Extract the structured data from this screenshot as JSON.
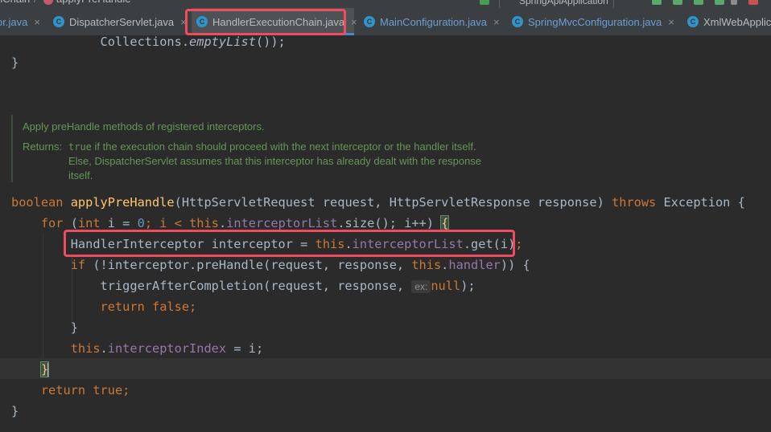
{
  "toolbar": {
    "breadcrumb_prefix": "nChain",
    "breadcrumb_sep": "/",
    "breadcrumb_method": "applyPreHandle",
    "run_config": "SpringApiApplication"
  },
  "tabs": [
    {
      "label": "or.java",
      "close": "×"
    },
    {
      "label": "DispatcherServlet.java",
      "close": "×"
    },
    {
      "label": "HandlerExecutionChain.java",
      "close": "×"
    },
    {
      "label": "MainConfiguration.java",
      "close": "×"
    },
    {
      "label": "SpringMvcConfiguration.java",
      "close": "×"
    },
    {
      "label": "XmlWebApplic",
      "close": ""
    }
  ],
  "icons": {
    "class_file": "C",
    "method_icon": "m"
  },
  "colors": {
    "highlight": "#ef4d5f",
    "accent": "#4a88c7",
    "keyword": "#cc7832",
    "method": "#ffc66d",
    "field": "#9876aa",
    "number": "#6897bb",
    "doc": "#629755"
  },
  "code": {
    "l1_call": "Collections.",
    "l1_method": "emptyList",
    "l1_end": "());",
    "l2": "}",
    "sig_kw": "boolean",
    "sig_name": "applyPreHandle",
    "sig_params": "(HttpServletRequest request, HttpServletResponse response) ",
    "sig_throws": "throws",
    "sig_exc": " Exception {",
    "for_kw": "for",
    "for_open": " (",
    "for_int": "int",
    "for_i": " i = ",
    "for_zero": "0",
    "for_semi1": "; i < ",
    "for_this": "this",
    "for_dot": ".",
    "for_field": "interceptorList",
    "for_size": ".size(); i++) ",
    "for_brace": "{",
    "decl_type": "HandlerInterceptor interceptor = ",
    "decl_this": "this",
    "decl_dot": ".",
    "decl_field": "interceptorList",
    "decl_get": ".get(i)",
    "decl_semi": ";",
    "if_kw": "if",
    "if_cond": " (!interceptor.preHandle(request, response, ",
    "if_this": "this",
    "if_dot": ".",
    "if_field": "handler",
    "if_end": ")) {",
    "trigger_call": "triggerAfterCompletion(request, response, ",
    "trigger_hint": "ex:",
    "trigger_null": "null",
    "trigger_end": ");",
    "ret_kw": "return",
    "ret_false": " false",
    "ret_semi": ";",
    "close_if": "}",
    "assign_this": "this",
    "assign_dot": ".",
    "assign_field": "interceptorIndex",
    "assign_end": " = i;",
    "close_for": "}",
    "ret2_kw": "return",
    "ret2_true": " true",
    "ret2_semi": ";",
    "close_method": "}"
  },
  "doc": {
    "summary": "Apply preHandle methods of registered interceptors.",
    "returns_label": "Returns:",
    "returns_code": "true",
    "returns_line1": " if the execution chain should proceed with the next interceptor or the handler itself.",
    "returns_line2": "Else, DispatcherServlet assumes that this interceptor has already dealt with the response",
    "returns_line3": "itself."
  }
}
